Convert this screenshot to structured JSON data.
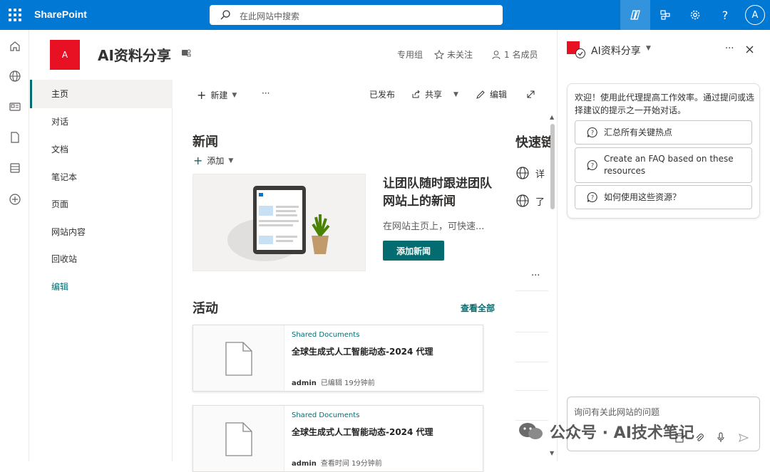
{
  "topbar": {
    "brand": "SharePoint",
    "search_placeholder": "在此网站中搜索",
    "avatar": "A",
    "help": "?"
  },
  "site": {
    "logo_letter": "A",
    "title": "AI资料分享",
    "privacy": "专用组",
    "follow": "未关注",
    "members": "1 名成员"
  },
  "nav": {
    "items": [
      {
        "label": "主页"
      },
      {
        "label": "对话"
      },
      {
        "label": "文档"
      },
      {
        "label": "笔记本"
      },
      {
        "label": "页面"
      },
      {
        "label": "网站内容"
      },
      {
        "label": "回收站"
      },
      {
        "label": "编辑"
      }
    ]
  },
  "commands": {
    "new": "新建",
    "more": "···",
    "published": "已发布",
    "share": "共享",
    "edit": "编辑"
  },
  "news": {
    "title": "新闻",
    "add": "添加",
    "hero_title": "让团队随时跟进团队网站上的新闻",
    "hero_desc": "在网站主页上，可快速...",
    "hero_button": "添加新闻"
  },
  "activity": {
    "title": "活动",
    "view_all": "查看全部",
    "cards": [
      {
        "source": "Shared Documents",
        "title": "全球生成式人工智能动态-2024 代理",
        "author": "admin",
        "meta": "已编辑 19分钟前"
      },
      {
        "source": "Shared Documents",
        "title": "全球生成式人工智能动态-2024 代理",
        "author": "admin",
        "meta": "查看时间 19分钟前"
      }
    ]
  },
  "quicklinks": {
    "title": "快速链",
    "items": [
      {
        "label": "详"
      },
      {
        "label": "了"
      }
    ],
    "more": "···"
  },
  "copilot": {
    "title": "AI资料分享",
    "intro": "欢迎！使用此代理提高工作效率。通过提问或选择建议的提示之一开始对话。",
    "suggestions": [
      {
        "label": "汇总所有关键热点"
      },
      {
        "label": "Create an FAQ based on these resources"
      },
      {
        "label": "如何使用这些资源？"
      }
    ],
    "input_placeholder": "询问有关此网站的问题"
  },
  "watermark": {
    "text": "公众号 · AI技术笔记"
  },
  "colors": {
    "brand": "#0078d4",
    "accent": "#036c70",
    "logo": "#e81123"
  }
}
